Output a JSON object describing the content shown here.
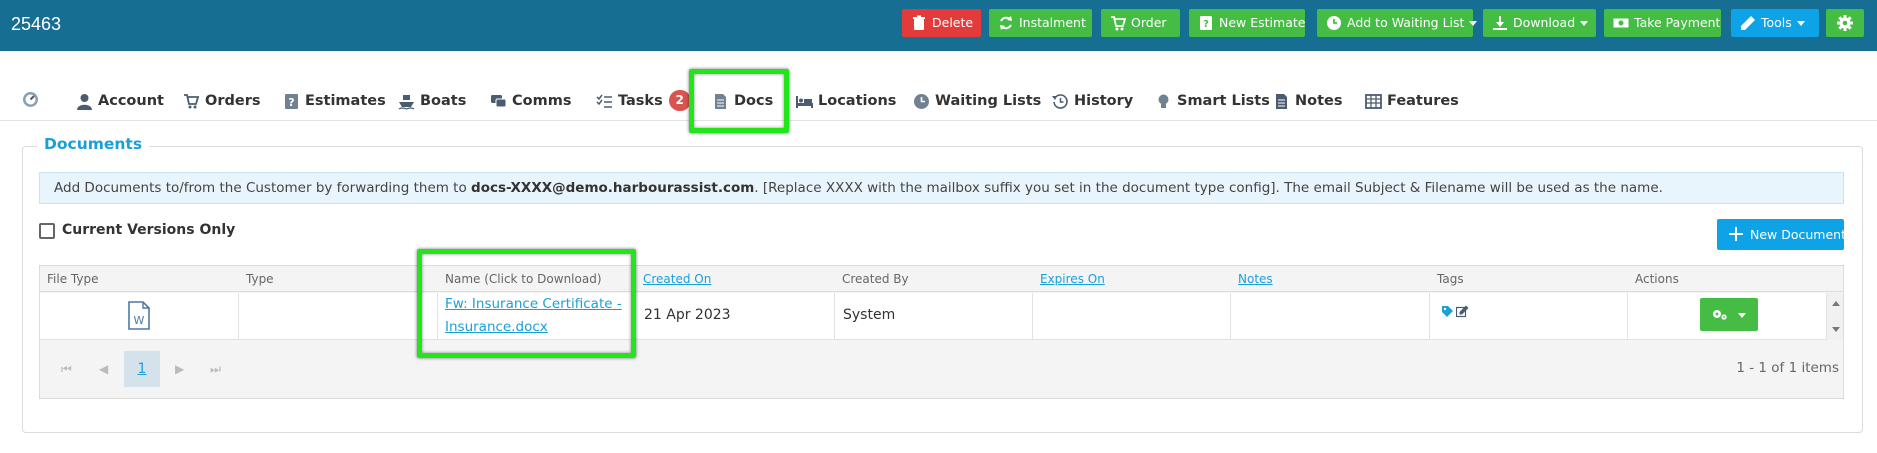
{
  "header": {
    "record_id": "25463",
    "buttons": {
      "delete": "Delete",
      "instalment": "Instalment",
      "order": "Order",
      "new_estimate": "New Estimate",
      "add_waiting_list": "Add to Waiting List",
      "download": "Download",
      "take_payment": "Take Payment",
      "tools": "Tools"
    }
  },
  "tabs": {
    "account": "Account",
    "orders": "Orders",
    "estimates": "Estimates",
    "boats": "Boats",
    "comms": "Comms",
    "tasks": "Tasks",
    "tasks_badge": "2",
    "docs": "Docs",
    "locations": "Locations",
    "waiting_lists": "Waiting Lists",
    "history": "History",
    "smart_lists": "Smart Lists",
    "notes": "Notes",
    "features": "Features"
  },
  "documents": {
    "title": "Documents",
    "info_prefix": "Add Documents to/from the Customer by forwarding them to ",
    "info_email": "docs-XXXX@demo.harbourassist.com",
    "info_suffix": ". [Replace XXXX with the mailbox suffix you set in the document type config]. The email Subject & Filename will be used as the name.",
    "current_versions_label": "Current Versions Only",
    "current_versions_checked": false,
    "new_document_label": "New Document",
    "columns": {
      "file_type": "File Type",
      "type": "Type",
      "name": "Name (Click to Download)",
      "created_on": "Created On",
      "created_by": "Created By",
      "expires_on": "Expires On",
      "notes": "Notes",
      "tags": "Tags",
      "actions": "Actions"
    },
    "rows": [
      {
        "file_type_icon": "word-doc-icon",
        "type": "",
        "name_line1": "Fw: Insurance Certificate -",
        "name_line2": "Insurance.docx",
        "created_on": "21 Apr 2023",
        "created_by": "System",
        "expires_on": "",
        "notes": ""
      }
    ],
    "pager": {
      "first": "⏮",
      "prev": "◀",
      "current_page": "1",
      "next": "▶",
      "last": "⏭",
      "items_info": "1 - 1 of 1 items"
    }
  },
  "colors": {
    "header_bg": "#166f92",
    "danger": "#e33b3b",
    "success": "#45bd45",
    "primary": "#0ea2e6",
    "link": "#1a9fd9",
    "highlight": "#22e61a"
  }
}
